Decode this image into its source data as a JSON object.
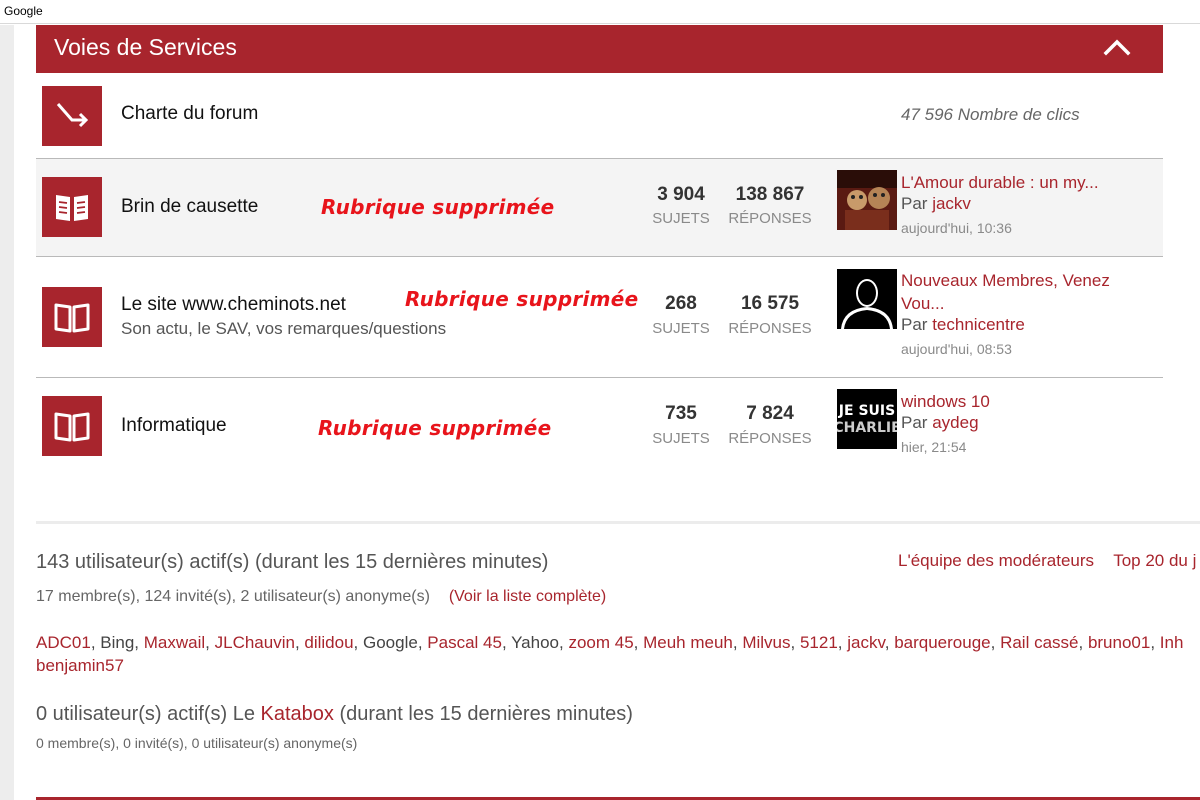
{
  "window": {
    "title": "Google"
  },
  "section": {
    "title": "Voies de Services"
  },
  "forums": [
    {
      "name": "Charte du forum",
      "clicks": "47 596 Nombre de clics"
    },
    {
      "name": "Brin de causette",
      "removed_note": "Rubrique supprimée",
      "topics": "3 904",
      "topics_label": "SUJETS",
      "replies": "138 867",
      "replies_label": "RÉPONSES",
      "last_post": {
        "title": "L'Amour durable : un my...",
        "by_prefix": "Par",
        "author": "jackv",
        "time": "aujourd'hui, 10:36"
      }
    },
    {
      "name": "Le site www.cheminots.net",
      "description": "Son actu, le SAV, vos remarques/questions",
      "removed_note": "Rubrique supprimée",
      "topics": "268",
      "topics_label": "SUJETS",
      "replies": "16 575",
      "replies_label": "RÉPONSES",
      "last_post": {
        "title": "Nouveaux Membres, Venez Vou...",
        "by_prefix": "Par",
        "author": "technicentre",
        "time": "aujourd'hui, 08:53"
      }
    },
    {
      "name": "Informatique",
      "removed_note": "Rubrique supprimée",
      "topics": "735",
      "topics_label": "SUJETS",
      "replies": "7 824",
      "replies_label": "RÉPONSES",
      "last_post": {
        "title": "windows 10",
        "by_prefix": "Par",
        "author": "aydeg",
        "time": "hier, 21:54",
        "avatar_text_1": "JE SUIS",
        "avatar_text_2": "CHARLIE"
      }
    }
  ],
  "active_users": {
    "title": "143 utilisateur(s) actif(s) (durant les 15 dernières minutes)",
    "summary": "17 membre(s), 124 invité(s), 2 utilisateur(s) anonyme(s)",
    "full_list_link": "(Voir la liste complète)",
    "moderators_link": "L'équipe des modérateurs",
    "top20_link": "Top 20 du j",
    "users": [
      {
        "name": "ADC01",
        "member": true
      },
      {
        "name": "Bing",
        "member": false
      },
      {
        "name": "Maxwail",
        "member": true
      },
      {
        "name": "JLChauvin",
        "member": true
      },
      {
        "name": "dilidou",
        "member": true
      },
      {
        "name": "Google",
        "member": false
      },
      {
        "name": "Pascal 45",
        "member": true
      },
      {
        "name": "Yahoo",
        "member": false
      },
      {
        "name": "zoom 45",
        "member": true
      },
      {
        "name": "Meuh meuh",
        "member": true
      },
      {
        "name": "Milvus",
        "member": true
      },
      {
        "name": "5121",
        "member": true
      },
      {
        "name": "jackv",
        "member": true
      },
      {
        "name": "barquerouge",
        "member": true
      },
      {
        "name": "Rail cassé",
        "member": true
      },
      {
        "name": "bruno01",
        "member": true
      },
      {
        "name": "Inh",
        "member": true
      }
    ],
    "last_user": "benjamin57"
  },
  "katabox": {
    "prefix": "0 utilisateur(s) actif(s) Le",
    "link": "Katabox",
    "suffix": "(durant les 15 dernières minutes)",
    "summary": "0 membre(s), 0 invité(s), 0 utilisateur(s) anonyme(s)"
  },
  "colors": {
    "brand": "#a8252d",
    "removed_note": "#e8141b"
  }
}
